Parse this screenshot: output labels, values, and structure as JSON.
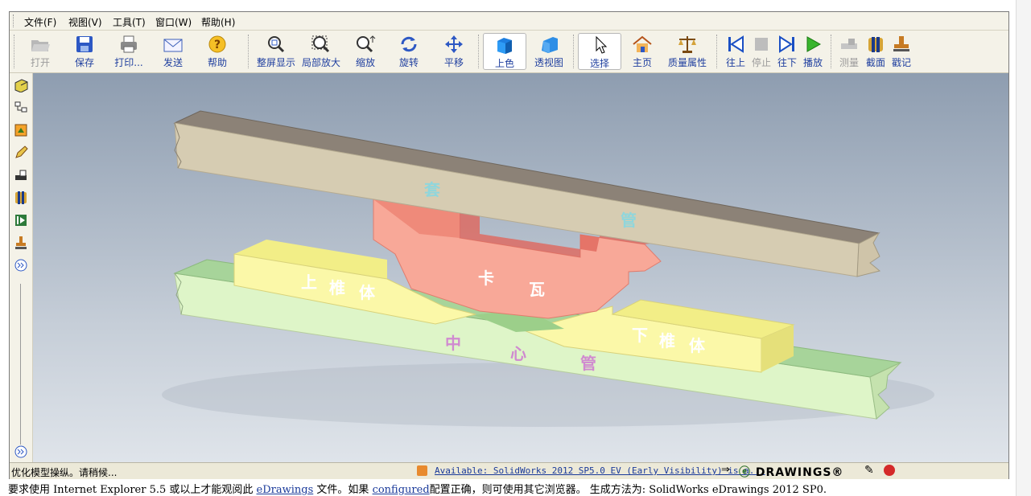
{
  "menu": [
    {
      "label": "文件(F)"
    },
    {
      "label": "视图(V)"
    },
    {
      "label": "工具(T)"
    },
    {
      "label": "窗口(W)"
    },
    {
      "label": "帮助(H)"
    }
  ],
  "toolbar": {
    "open": "打开",
    "save": "保存",
    "print": "打印...",
    "send": "发送",
    "help": "帮助",
    "zoom_fit": "整屏显示",
    "zoom_area": "局部放大",
    "zoom": "缩放",
    "rotate": "旋转",
    "pan": "平移",
    "shaded": "上色",
    "perspective": "透视图",
    "select": "选择",
    "home": "主页",
    "mass_props": "质量属性",
    "first": "往上",
    "stop": "停止",
    "next": "往下",
    "play": "播放",
    "measure": "测量",
    "section": "截面",
    "stamp": "戳记"
  },
  "model_labels": {
    "sleeve": [
      "套",
      "管"
    ],
    "clamp": [
      "卡",
      "瓦"
    ],
    "upper_cone": [
      "上",
      "椎",
      "体"
    ],
    "lower_cone": [
      "下",
      "椎",
      "体"
    ],
    "center_pipe": [
      "中",
      "心",
      "管"
    ]
  },
  "status": {
    "text": "优化模型操纵。请稍候...",
    "news": "Available: SolidWorks 2012 SP5.0 EV (Early Visibility) is a...",
    "brand": "DRAWINGS®"
  },
  "footer": {
    "part1": "要求使用 Internet Explorer 5.5 或以上才能观阅此",
    "link1": "eDrawings",
    "part2": "文件。如果",
    "link2": "configured",
    "part3": "配置正确，则可使用其它浏览器。 生成方法为: SolidWorks eDrawings 2012 SP0."
  },
  "colors": {
    "sleeve": "#d6ccb2",
    "clamp": "#f5a291",
    "cone": "#f7f38f",
    "center_pipe": "#def5c8",
    "pipe_band": "#9ccf8a"
  }
}
